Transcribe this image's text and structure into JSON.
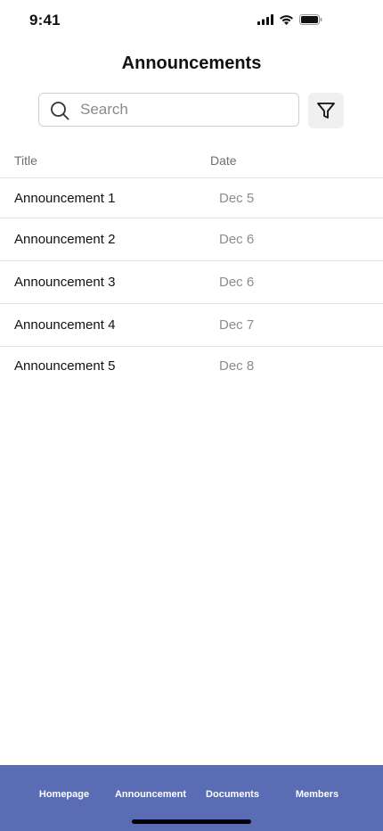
{
  "status_bar": {
    "time": "9:41"
  },
  "header": {
    "title": "Announcements"
  },
  "search": {
    "placeholder": "Search",
    "value": ""
  },
  "table": {
    "columns": {
      "title": "Title",
      "date": "Date"
    },
    "rows": [
      {
        "title": "Announcement 1",
        "date": "Dec 5"
      },
      {
        "title": "Announcement 2",
        "date": "Dec 6"
      },
      {
        "title": "Announcement 3",
        "date": "Dec 6"
      },
      {
        "title": "Announcement 4",
        "date": "Dec 7"
      },
      {
        "title": "Announcement 5",
        "date": "Dec 8"
      }
    ]
  },
  "tab_bar": {
    "tabs": [
      {
        "label": "Homepage"
      },
      {
        "label": "Announcement"
      },
      {
        "label": "Documents"
      },
      {
        "label": "Members"
      }
    ]
  },
  "colors": {
    "tab_bar_bg": "#5a6cb3",
    "divider": "#e2e2e2",
    "muted_text": "#8c8c8c"
  },
  "icons": [
    "signal-icon",
    "wifi-icon",
    "battery-icon",
    "search-icon",
    "filter-icon"
  ]
}
